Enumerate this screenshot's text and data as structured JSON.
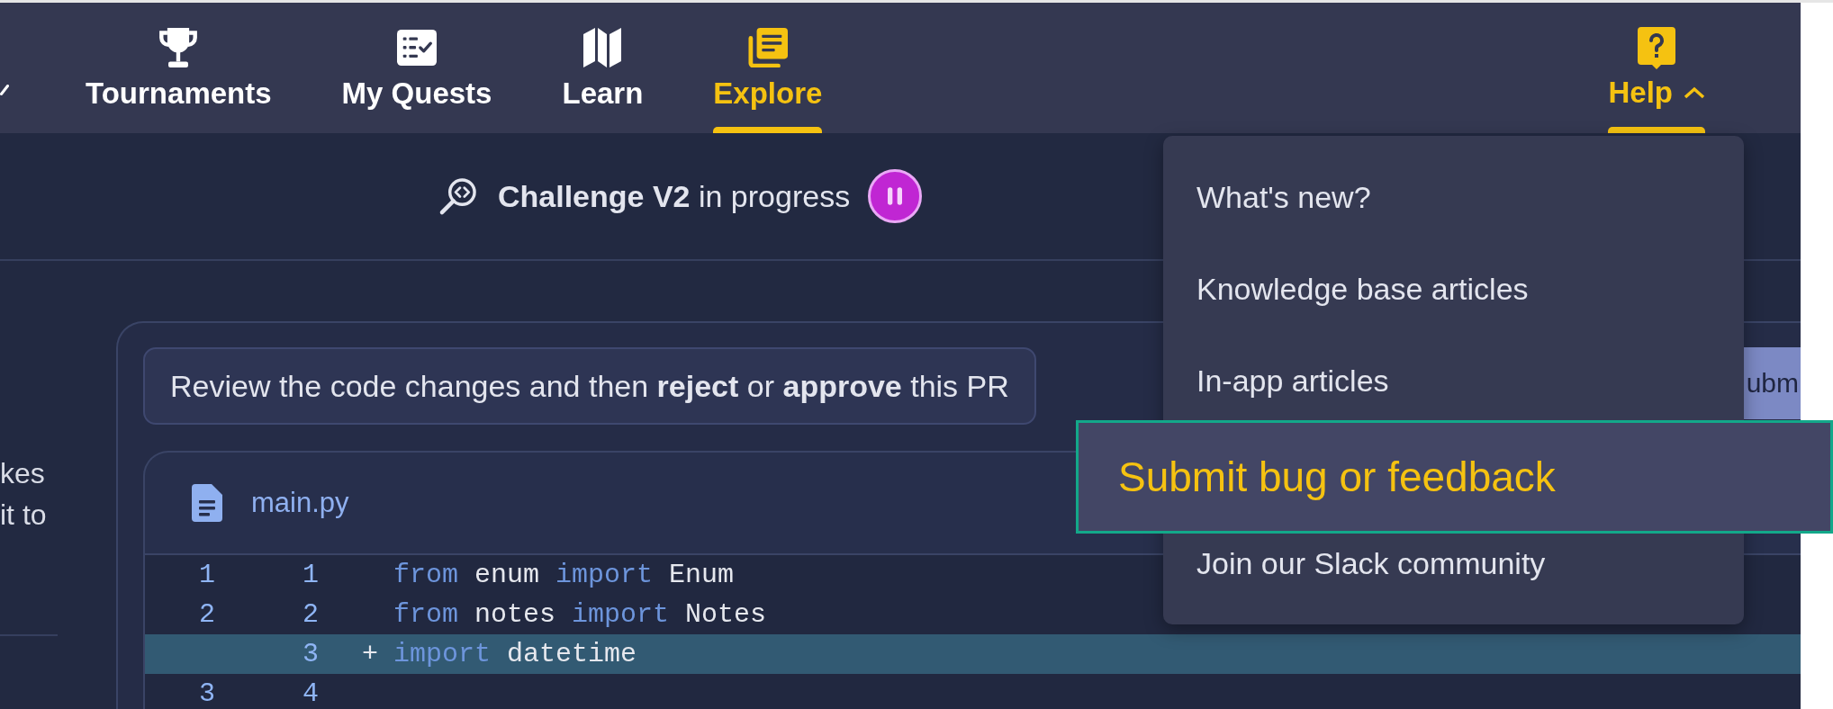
{
  "nav": {
    "tabs": [
      {
        "label": "Tournaments",
        "selected": false
      },
      {
        "label": "My Quests",
        "selected": false
      },
      {
        "label": "Learn",
        "selected": false
      },
      {
        "label": "Explore",
        "selected": true
      }
    ],
    "help": {
      "label": "Help",
      "expanded": true,
      "menu": [
        {
          "label": "What's new?",
          "selected": false
        },
        {
          "label": "Knowledge base articles",
          "selected": false
        },
        {
          "label": "In-app articles",
          "selected": false
        },
        {
          "label": "Submit bug or feedback",
          "selected": true
        },
        {
          "label": "Join our Slack community",
          "selected": false
        }
      ]
    }
  },
  "challenge_bar": {
    "status": "**Challenge V2** in progress"
  },
  "side_panel": {
    "text_lines": [
      "kes",
      "it to"
    ]
  },
  "review": {
    "instruction": "Review the code changes and then **reject** or **approve** this PR",
    "action_button": "ubm",
    "file": {
      "name": "main.py",
      "lines": [
        {
          "kind": "context",
          "old_number": "1",
          "new_number": "1",
          "code": [
            {
              "kind": "keyword",
              "text": "from"
            },
            {
              "kind": "name",
              "text": "enum"
            },
            {
              "kind": "keyword",
              "text": "import"
            },
            {
              "kind": "name",
              "text": "Enum"
            }
          ]
        },
        {
          "kind": "context",
          "old_number": "2",
          "new_number": "2",
          "code": [
            {
              "kind": "keyword",
              "text": "from"
            },
            {
              "kind": "name",
              "text": "notes"
            },
            {
              "kind": "keyword",
              "text": "import"
            },
            {
              "kind": "name",
              "text": "Notes"
            }
          ]
        },
        {
          "kind": "added",
          "new_number": "3",
          "sign": "+",
          "code": [
            {
              "kind": "keyword",
              "text": "import"
            },
            {
              "kind": "name",
              "text": "datetime"
            }
          ]
        },
        {
          "kind": "context",
          "old_number": "3",
          "new_number": "4"
        }
      ]
    }
  }
}
